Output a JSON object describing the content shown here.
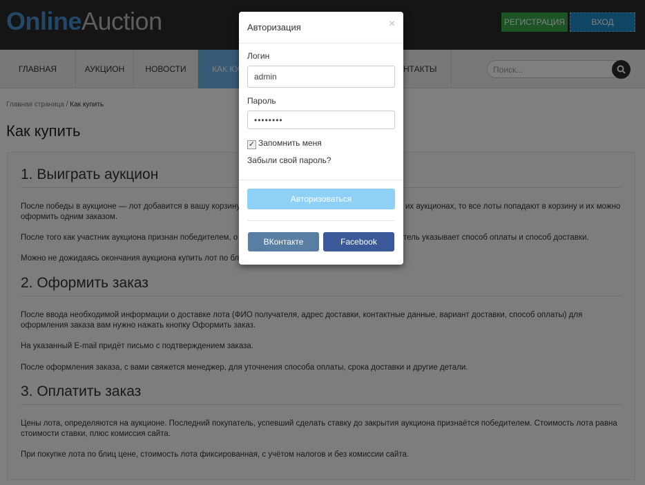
{
  "header": {
    "logo_part1": "Online",
    "logo_part2": "Auction",
    "register": "РЕГИСТРАЦИЯ",
    "login": "ВХОД"
  },
  "nav": {
    "items": [
      "ГЛАВНАЯ",
      "АУКЦИОН",
      "НОВОСТИ",
      "КАК КУ",
      "НТАКТЫ"
    ],
    "search_placeholder": "Поиск..."
  },
  "breadcrumb": {
    "home": "Главная страница",
    "sep": "/",
    "current": "Как купить"
  },
  "page_title": "Как купить",
  "sections": [
    {
      "heading": "1. Выиграть аукцион",
      "lines": [
        {
          "left": "После победы в аукционе — лот добавится в вашу корзину.",
          "right": "их аукционах, то все лоты попадают в корзину и их можно"
        },
        {
          "left": "оформить одним заказом."
        },
        {
          "left": "После того как участник аукциона признан победителем, о",
          "right": "тель указывает способ оплаты и способ доставки."
        },
        {
          "left": "Можно не дожидаясь окончания аукциона купить лот по бл"
        }
      ]
    },
    {
      "heading": "2. Оформить заказ",
      "lines": [
        "После ввода необходимой информации о доставке лота (ФИО получателя, адрес доставки, контактные данные, вариант доставки, способ оплаты) для",
        "оформления заказа вам нужно нажать кнопку Оформить заказ.",
        "На указанный E-mail придёт письмо с подтверждением заказа.",
        "После оформления заказа, с вами свяжется менеджер, для уточнения способа оплаты, срока доставки и другие детали."
      ]
    },
    {
      "heading": "3. Оплатить заказ",
      "lines": [
        "Цены лота, определяются на аукционе. Последний покупатель, успевший сделать ставку до закрытия аукциона признаётся победителем. Стоимость лота равна",
        "стоимости ставки, плюс комиссия сайта.",
        "При покупке лота по блиц цене, стоимость лота фиксированная, с учётом налогов и без комиссии сайта."
      ]
    }
  ],
  "modal": {
    "title": "Авторизация",
    "close": "×",
    "login_label": "Логин",
    "login_value": "admin",
    "password_label": "Пароль",
    "password_value": "••••••••",
    "remember": "Запомнить меня",
    "remember_checked": true,
    "forgot": "Забыли свой пароль?",
    "submit": "Авторизоваться",
    "vk": "ВКонтакте",
    "facebook": "Facebook"
  },
  "colors": {
    "brand": "#4a8fcf",
    "register": "#3aa94a",
    "login": "#1f8ccc",
    "submit": "#8fd0f7",
    "vk": "#587ea3",
    "facebook": "#3b5998"
  }
}
